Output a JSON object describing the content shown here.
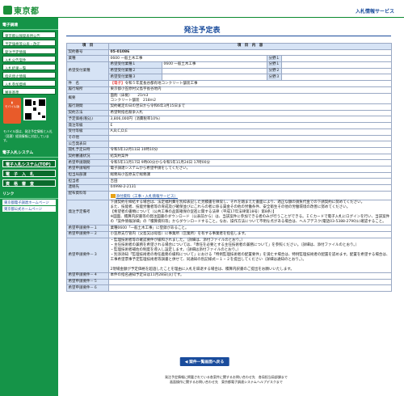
{
  "header": {
    "logo_text": "東京都",
    "right_link": "入札情報サービス"
  },
  "sidebar": {
    "section1": "電子調達",
    "menu": [
      "東京都公報発表用公告",
      "予定価格等公表・改正",
      "発注予定情報",
      "入札公告案件",
      "入札結果一覧",
      "指名停止情報",
      "入札参加資格",
      "審査基準"
    ],
    "mobile_label": "モバイル版",
    "mobile_note": "モバイル版は、発注予定情報と入札（見積）経過情報に対応しています。",
    "section2": "電子入札システム",
    "section2_items": [
      "電子入札システム(TOP)",
      "電　子　入　札",
      "資　格　審　査"
    ],
    "section3": "リンク",
    "links": [
      "東京都電子調達ホームページ",
      "東京都公式ホームページ"
    ]
  },
  "page_title": "発注予定表",
  "table": {
    "head_item": "項　目",
    "head_content": "項　目　内　容",
    "contract_no_label": "契約番号",
    "contract_no": "05-01086",
    "industry_label": "業種",
    "industry": "0600 一般土木工事",
    "subfield_label": "分野１",
    "hope_label": "希望受付業種",
    "hope_rows": [
      {
        "name": "希望受付業種１",
        "value": "0600 一般土木工事",
        "field": "分野１"
      },
      {
        "name": "希望受付業種２",
        "value": "",
        "field": "分野２"
      },
      {
        "name": "希望受付業種３",
        "value": "",
        "field": "分野３"
      }
    ],
    "name_label": "件　名",
    "name_tag": "【電子】",
    "name_value": "令和５年度長谷都有地コンクリート舗装工事",
    "place_label": "履行場所",
    "place": "東京都小笠原村父島字長谷地内",
    "summary_label": "概要",
    "summary": "面削（床掘）　　21ｍ3\nコンクリート舗装　218ｍ2",
    "period_label": "履行期間",
    "period": "契約確定の日の翌日から令和6年3月15日まで",
    "method_label": "契約方法",
    "method": "希望制指名競争入札",
    "price_label": "予定価格(税込)",
    "price": "3,806,000円（消費税率10%）",
    "grade_label": "発注等級",
    "grade": "E",
    "hope_grade_label": "受付等級",
    "hope_grade": "A,B,C,D,E",
    "other_label": "その他",
    "other": "",
    "announce_label": "公告発表日",
    "announce": "",
    "open_label": "開札予定日時",
    "open": "令和5年12月11日 10時10分",
    "status_label": "契約審議状況",
    "status": "結契約案件",
    "hope_period_label": "希望申請期間",
    "hope_period": "令和5年11月17日 9時00分から令和5年11月24日 17時00分",
    "hope_place_label": "希望申請場所",
    "hope_place": "電子調達システムから希望申請をしてください。",
    "dept_label": "担当局部課",
    "dept": "総務局小笠原支庁総務課",
    "person_label": "担当者",
    "person": "吉田",
    "tel_label": "連絡先",
    "tel": "04998-2-2131",
    "doc_label": "配布資料等",
    "doc_link": "添付資料（工事・入札情報サービス）",
    "remarks_label": "発注予定備考",
    "remarks": "下請契約を締結する場合は、法定福利費を別枠表記した見積書を徴収し、それを踏まえた書面により、適正な額の請負代金での下請契約に努めてください。\nまた、技能者、技能労働者等の育成及び確保並びにこれらの者に係る賃金その他の労働条件、安全衛生その他の労働環境の改善に努めてください。\n【希望者の書類について（公共工事の品質確保の促進に関する法律（平成17年法律第18号）第8条）】\n※図面、積算内訳書等の発注図書のダウンロード（公表前から）は、当該案件に参加できる者のみが行うことができる。ＩＣカードで電子入札にログインを行い、当該案件の「案件情報詳細」の「積算資料等」からダウンロードすること。なお、操作方法について不明な点がある場合は、ヘルプデスク(電話03-5388-2790)に確認すること。",
    "req": [
      {
        "label": "希望申請要件－１",
        "value": "業種0600「一般土木工事」に登録があること。"
      },
      {
        "label": "希望申請要件－２",
        "value": "小笠原支庁管内（父島又は母島）に事業所（営業所）を有する事業者を指名します。"
      },
      {
        "label": "希望申請要件－３",
        "value": "・監理技術者等の確認要件が緩和されました。（詳細は、添付ファイルのとおり。）\n・主任技術者の兼務を希望される場合については、「専任を必要とする主任技術者の兼務について」を参照ください。（詳細は、添付ファイルのとおり。）\n・監理技術者補佐の制度を導入し設定します。（詳細は添付ファイルのとおり。）\n・別添添知「監理技術者の専任義務の緩和について」における「特例監理技術者の配置要件」を満たす場合は、特例監理技術者の配置を認めます。配置を希望する場合は、工事希望票事予定監理技術者等調書と併せて、同通知の別記様式ー１・２を提出してください（詳細は通知のとおり。）。\n\n2現場金額が予定価格を超過したことを理由に入札を辞退する場合は、積算内訳書のご提出をお願いいたします。"
      },
      {
        "label": "希望申請要件－４",
        "value": "本件の指名通知予定日は11月28日(火)です。"
      },
      {
        "label": "希望申請要件－５",
        "value": ""
      },
      {
        "label": "希望申請要件－６",
        "value": ""
      }
    ]
  },
  "back_button": "◀ 案件一覧画面へ戻る",
  "footer": "発注予定情報に掲載されている各案件に関するお問い合わせ先　各局担当局部課まで\n画面操作に関するお問い合わせ先　東京都電子調達システムヘルプデスクまで"
}
